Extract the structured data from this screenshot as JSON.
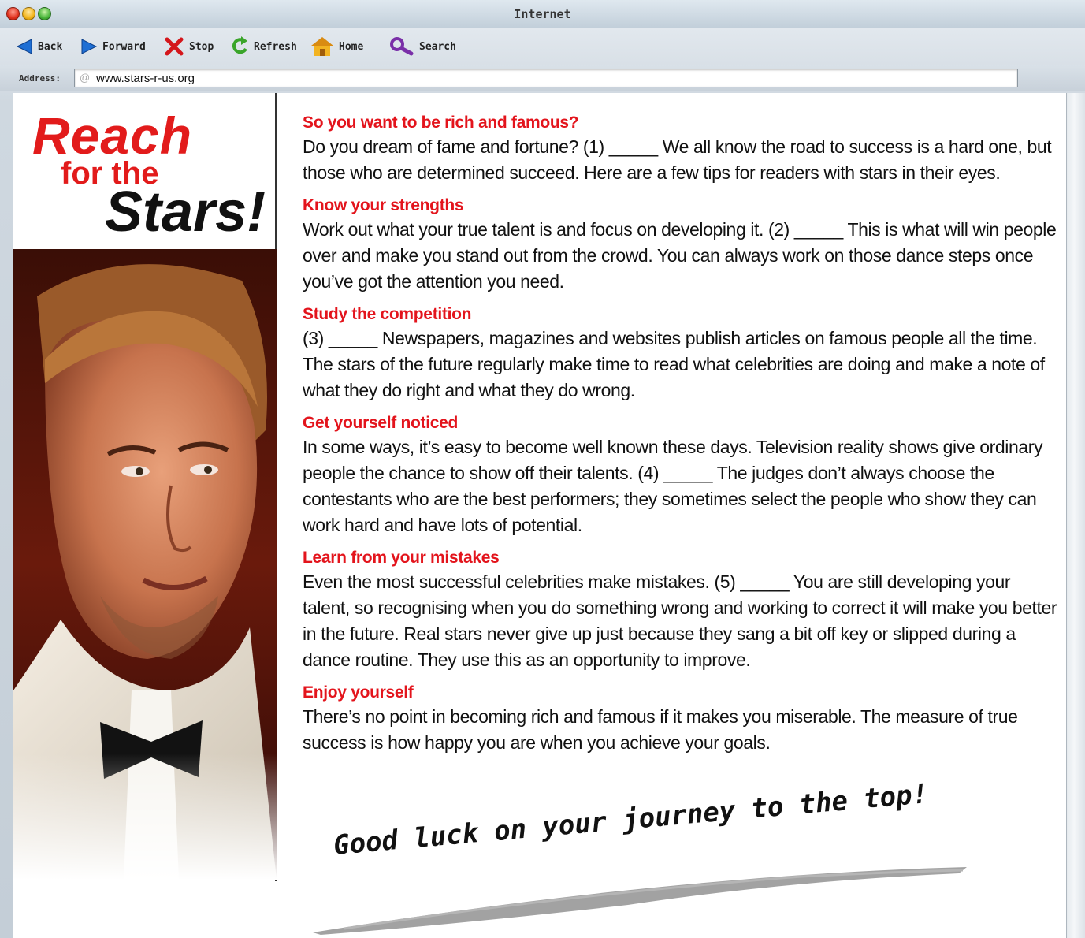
{
  "window": {
    "title": "Internet"
  },
  "toolbar": {
    "back": "Back",
    "forward": "Forward",
    "stop": "Stop",
    "refresh": "Refresh",
    "home": "Home",
    "search": "Search"
  },
  "address": {
    "label": "Address:",
    "url": "www.stars-r-us.org"
  },
  "logo": {
    "line1": "Reach",
    "line2": "for the",
    "line3": "Stars!"
  },
  "article": {
    "sections": [
      {
        "heading": "So you want to be rich and famous?",
        "body": "Do you dream of fame and fortune? (1) _____ We all know the road to success is a hard one, but those who are determined succeed. Here are a few tips for readers with stars in their eyes."
      },
      {
        "heading": "Know your strengths",
        "body": "Work out what your true talent is and focus on developing it. (2) _____ This is what will win people over and make you stand out from the crowd. You can always work on those dance steps once you’ve got the attention you need."
      },
      {
        "heading": "Study the competition",
        "body": "(3) _____ Newspapers, magazines and websites publish articles on famous people all the time. The stars of the future regularly make time to read what celebrities are doing and make a note of what they do right and what they do wrong."
      },
      {
        "heading": "Get yourself noticed",
        "body": "In some ways, it’s easy to become well known these days. Television reality shows give ordinary people the chance to show off their talents. (4) _____ The judges don’t always choose the contestants who are the best performers; they sometimes select the people who show they can work hard and have lots of potential."
      },
      {
        "heading": "Learn from your mistakes",
        "body": "Even the most successful celebrities make mistakes. (5) _____ You are still developing your talent, so recognising when you do something wrong and working to correct it will make you better in the future. Real stars never give up just because they sang a bit off key or slipped during a dance routine. They use this as an opportunity to improve."
      },
      {
        "heading": "Enjoy yourself",
        "body": "There’s no point in becoming rich and famous if it makes you miserable. The measure of true success is how happy you are when you achieve your goals."
      }
    ],
    "closing": "Good luck on your journey to the top!"
  }
}
